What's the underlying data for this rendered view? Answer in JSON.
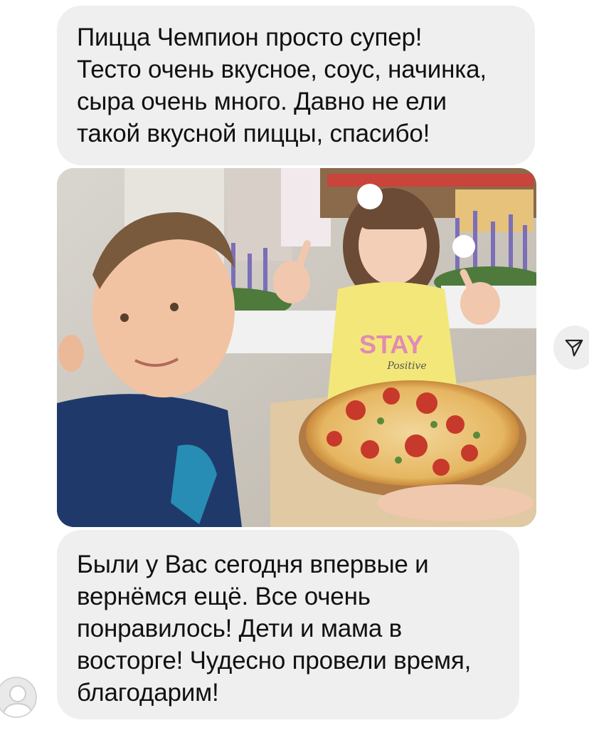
{
  "messages": [
    {
      "lines": [
        "Пицца Чемпион просто супер!",
        "Тесто очень вкусное, соус, начинка,",
        "сыра очень много. Давно не ели",
        "такой вкусной пиццы, спасибо!"
      ]
    },
    {
      "lines": [
        "Были у Вас сегодня впервые и",
        "вернёмся ещё. Все очень",
        "понравилось! Дети и мама в",
        "восторге! Чудесно провели время,",
        "благодарим!"
      ]
    }
  ],
  "photo": {
    "shirt_print": "STAY",
    "shirt_print_script": "Positive"
  },
  "icons": {
    "share": "paper-plane-icon",
    "avatar": "user-avatar-icon"
  },
  "colors": {
    "bubble": "#efefef",
    "text": "#111111",
    "background": "#ffffff"
  }
}
